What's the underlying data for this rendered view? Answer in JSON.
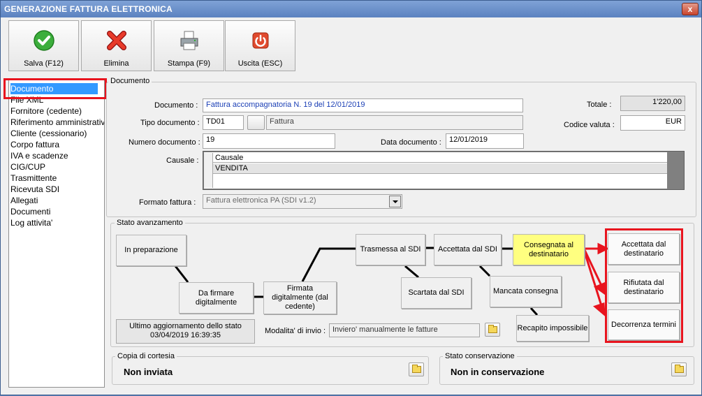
{
  "window": {
    "title": "GENERAZIONE FATTURA ELETTRONICA",
    "close_glyph": "x"
  },
  "toolbar": {
    "save_label": "Salva (F12)",
    "delete_label": "Elimina",
    "print_label": "Stampa (F9)",
    "exit_label": "Uscita (ESC)"
  },
  "nav": {
    "items": [
      "Documento",
      "File XML",
      "Fornitore (cedente)",
      "Riferimento amministrativo",
      "Cliente (cessionario)",
      "Corpo fattura",
      "IVA e scadenze",
      "CIG/CUP",
      "Trasmittente",
      "Ricevuta SDI",
      "Allegati",
      "Documenti",
      "Log attivita'"
    ],
    "selected_index": 0
  },
  "documento": {
    "group_label": "Documento",
    "documento_label": "Documento :",
    "documento_value": "Fattura accompagnatoria N. 19 del 12/01/2019",
    "tipo_label": "Tipo documento :",
    "tipo_code": "TD01",
    "tipo_desc": "Fattura",
    "numero_label": "Numero documento :",
    "numero_value": "19",
    "data_label": "Data documento :",
    "data_value": "12/01/2019",
    "causale_label": "Causale :",
    "causale_header": "Causale",
    "causale_rows": [
      "VENDITA"
    ],
    "formato_label": "Formato fattura :",
    "formato_value": "Fattura elettronica PA (SDI v1.2)",
    "totale_label": "Totale :",
    "totale_value": "1'220,00",
    "valuta_label": "Codice valuta :",
    "valuta_value": "EUR"
  },
  "stato": {
    "group_label": "Stato avanzamento",
    "nodes": {
      "preparazione": "In preparazione",
      "da_firmare": "Da firmare digitalmente",
      "firmata": "Firmata digitalmente (dal cedente)",
      "trasmessa": "Trasmessa al SDI",
      "scartata": "Scartata dal SDI",
      "accettata_sdi": "Accettata dal SDI",
      "mancata": "Mancata consegna",
      "consegnata": "Consegnata al destinatario",
      "recapito": "Recapito impossibile",
      "accettata_dest": "Accettata dal destinatario",
      "rifiutata_dest": "Rifiutata dal destinatario",
      "decorrenza": "Decorrenza termini"
    },
    "ultimo_label": "Ultimo aggiornamento dello stato",
    "ultimo_value": "03/04/2019 16:39:35",
    "modalita_label": "Modalita' di invio :",
    "modalita_value": "Inviero' manualmente le fatture"
  },
  "copia": {
    "group_label": "Copia di cortesia",
    "value": "Non inviata"
  },
  "conservazione": {
    "group_label": "Stato conservazione",
    "value": "Non in conservazione"
  },
  "colors": {
    "highlight_red": "#e8141e",
    "selection_blue": "#3399ff",
    "consegnata_yellow": "#ffff80"
  },
  "icons": {
    "save": "green-check-icon",
    "delete": "red-x-icon",
    "print": "printer-icon",
    "exit": "power-icon",
    "folder": "folder-icon"
  }
}
